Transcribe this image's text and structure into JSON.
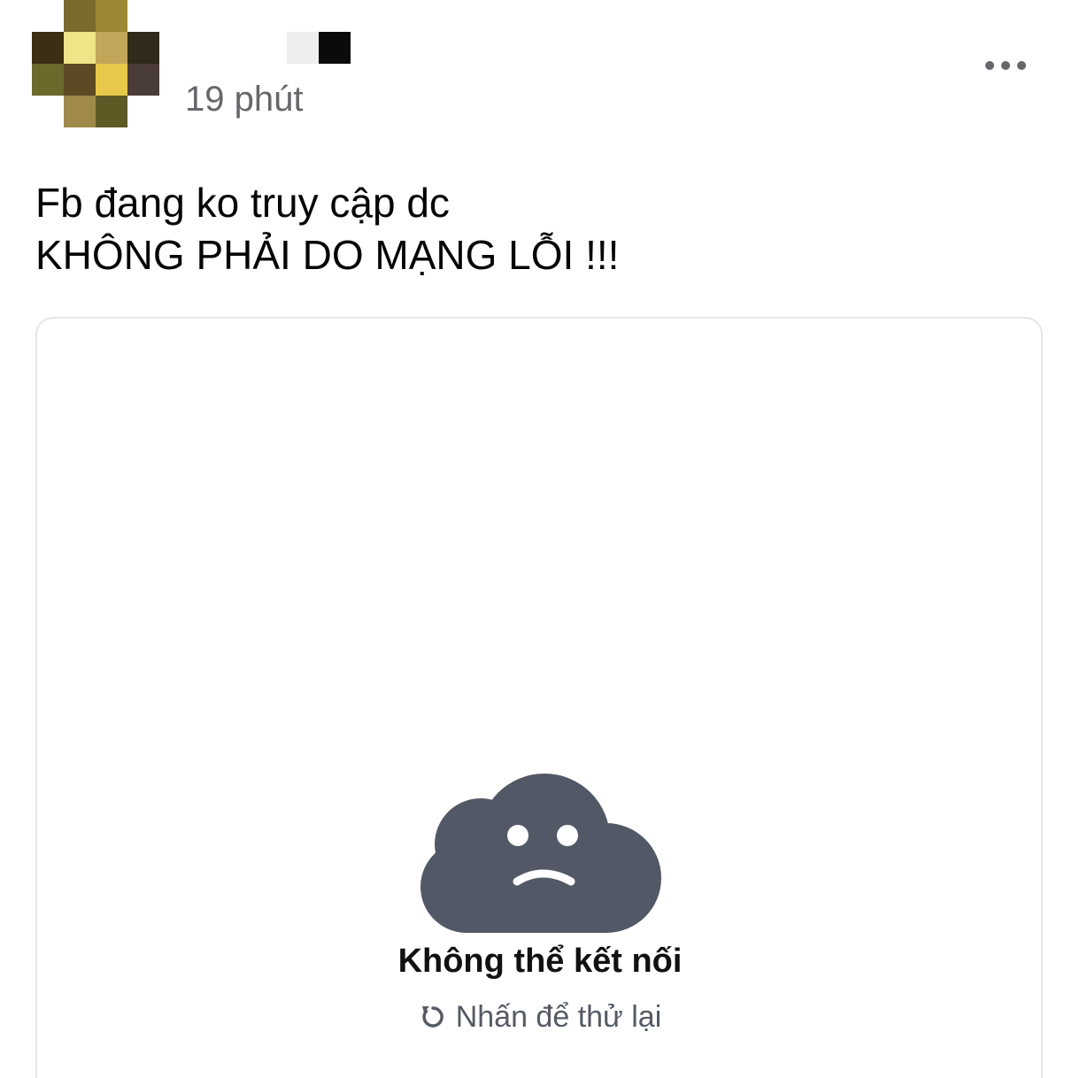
{
  "post": {
    "timestamp": "19 phút",
    "text_lines": [
      "Fb đang ko truy cập dc",
      "KHÔNG PHẢI DO MẠNG LỖI !!!"
    ],
    "more_icon": "more-horizontal-icon"
  },
  "link_preview": {
    "error_icon": "sad-cloud-icon",
    "error_title": "Không thể kết nối",
    "retry_icon": "refresh-icon",
    "retry_label": "Nhấn để thử lại"
  },
  "colors": {
    "cloud": "#535866",
    "text": "#050505",
    "secondary_text": "#65676b",
    "card_border": "#e4e6eb"
  }
}
